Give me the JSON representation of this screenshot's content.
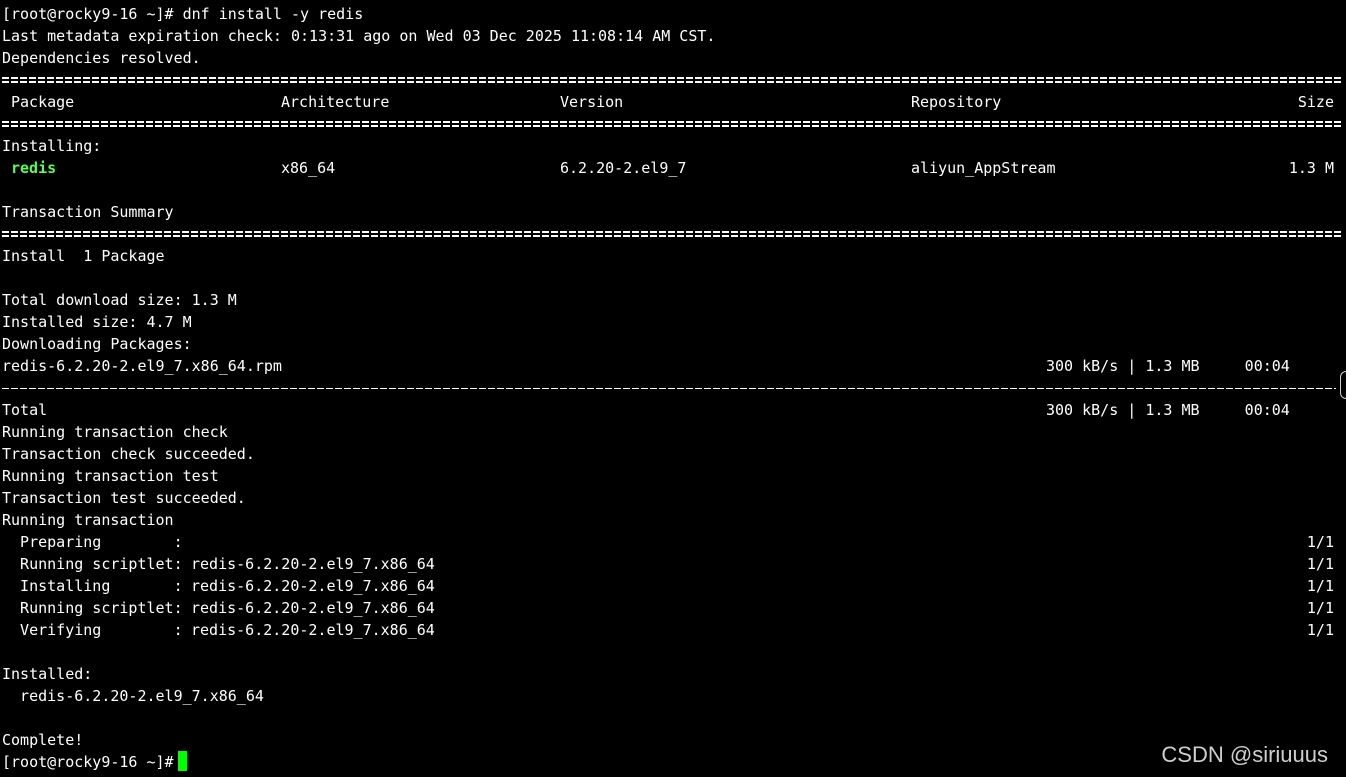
{
  "prompt_top": "[root@rocky9-16 ~]# dnf install -y redis",
  "metadata_line": "Last metadata expiration check: 0:13:31 ago on Wed 03 Dec 2025 11:08:14 AM CST.",
  "deps_line": "Dependencies resolved.",
  "table": {
    "headers": {
      "package": "Package",
      "arch": "Architecture",
      "version": "Version",
      "repo": "Repository",
      "size": "Size"
    },
    "section_label": "Installing:",
    "row": {
      "package": "redis",
      "arch": "x86_64",
      "version": "6.2.20-2.el9_7",
      "repo": "aliyun_AppStream",
      "size": "1.3 M"
    }
  },
  "summary": {
    "title": "Transaction Summary",
    "install_line": "Install  1 Package"
  },
  "sizes": {
    "download": "Total download size: 1.3 M",
    "installed": "Installed size: 4.7 M",
    "downloading": "Downloading Packages:"
  },
  "download": {
    "file": "redis-6.2.20-2.el9_7.x86_64.rpm",
    "stats": "300 kB/s | 1.3 MB     00:04",
    "total_label": "Total",
    "total_stats": "300 kB/s | 1.3 MB     00:04"
  },
  "transaction_lines": [
    "Running transaction check",
    "Transaction check succeeded.",
    "Running transaction test",
    "Transaction test succeeded.",
    "Running transaction"
  ],
  "steps": [
    {
      "label": "  Preparing        :",
      "pkg": "",
      "progress": "1/1"
    },
    {
      "label": "  Running scriptlet:",
      "pkg": "redis-6.2.20-2.el9_7.x86_64",
      "progress": "1/1"
    },
    {
      "label": "  Installing       :",
      "pkg": "redis-6.2.20-2.el9_7.x86_64",
      "progress": "1/1"
    },
    {
      "label": "  Running scriptlet:",
      "pkg": "redis-6.2.20-2.el9_7.x86_64",
      "progress": "1/1"
    },
    {
      "label": "  Verifying        :",
      "pkg": "redis-6.2.20-2.el9_7.x86_64",
      "progress": "1/1"
    }
  ],
  "installed": {
    "label": "Installed:",
    "pkg": "  redis-6.2.20-2.el9_7.x86_64"
  },
  "complete": "Complete!",
  "prompt_bottom": "[root@rocky9-16 ~]#",
  "watermark": "CSDN @siriuuus",
  "colors": {
    "background": "#000000",
    "text": "#ffffff",
    "package_highlight": "#55ff55",
    "cursor": "#00ff00"
  }
}
